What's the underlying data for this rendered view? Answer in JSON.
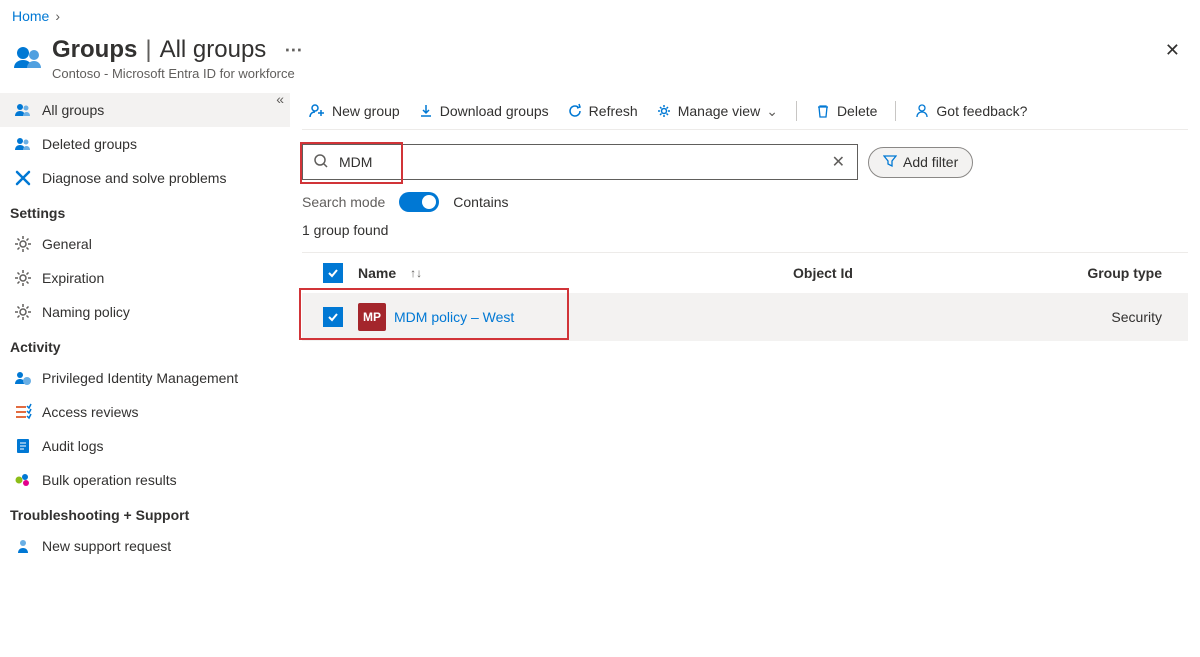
{
  "breadcrumb": {
    "home": "Home"
  },
  "header": {
    "title_strong": "Groups",
    "title_light": "All groups",
    "subtitle": "Contoso - Microsoft Entra ID for workforce"
  },
  "sidebar": {
    "items_top": [
      {
        "label": "All groups",
        "icon": "groups",
        "active": true
      },
      {
        "label": "Deleted groups",
        "icon": "groups",
        "active": false
      },
      {
        "label": "Diagnose and solve problems",
        "icon": "diagnose",
        "active": false
      }
    ],
    "section_settings": "Settings",
    "items_settings": [
      {
        "label": "General",
        "icon": "gear"
      },
      {
        "label": "Expiration",
        "icon": "gear"
      },
      {
        "label": "Naming policy",
        "icon": "gear"
      }
    ],
    "section_activity": "Activity",
    "items_activity": [
      {
        "label": "Privileged Identity Management",
        "icon": "pim"
      },
      {
        "label": "Access reviews",
        "icon": "reviews"
      },
      {
        "label": "Audit logs",
        "icon": "logs"
      },
      {
        "label": "Bulk operation results",
        "icon": "bulk"
      }
    ],
    "section_support": "Troubleshooting + Support",
    "items_support": [
      {
        "label": "New support request",
        "icon": "support"
      }
    ]
  },
  "toolbar": {
    "new_group": "New group",
    "download": "Download groups",
    "refresh": "Refresh",
    "manage_view": "Manage view",
    "delete": "Delete",
    "feedback": "Got feedback?"
  },
  "search": {
    "value": "MDM",
    "mode_label": "Search mode",
    "mode_value": "Contains",
    "add_filter": "Add filter"
  },
  "results": {
    "count_text": "1 group found"
  },
  "table": {
    "headers": {
      "name": "Name",
      "object_id": "Object Id",
      "group_type": "Group type"
    },
    "rows": [
      {
        "avatar": "MP",
        "name": "MDM policy – West",
        "object_id": "",
        "group_type": "Security",
        "checked": true
      }
    ]
  }
}
